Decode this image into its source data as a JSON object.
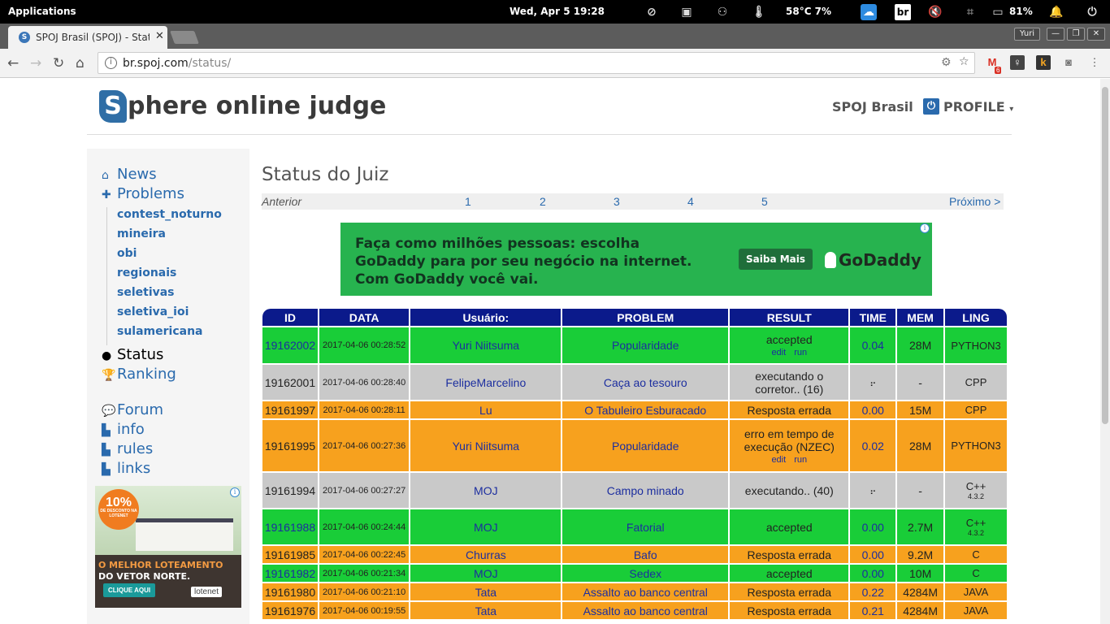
{
  "system_bar": {
    "applications": "Applications",
    "datetime": "Wed, Apr 5   19:28",
    "temperature": "58°C 7%",
    "keyboard": "br",
    "battery": "81%"
  },
  "browser": {
    "tab_title": "SPOJ Brasil (SPOJ) - Stat",
    "user": "Yuri",
    "url_host": "br.spoj.com",
    "url_path": "/status/",
    "gmail_badge": "6"
  },
  "site": {
    "logo_letter": "S",
    "logo_rest": "phere online judge",
    "brand": "SPOJ Brasil",
    "profile": "PROFILE"
  },
  "sidebar": {
    "main_top": [
      {
        "label": "News",
        "icon": "home-icon"
      },
      {
        "label": "Problems",
        "icon": "puzzle-icon"
      }
    ],
    "problem_groups": [
      "contest_noturno",
      "mineira",
      "obi",
      "regionais",
      "seletivas",
      "seletiva_ioi",
      "sulamericana"
    ],
    "status": "Status",
    "ranking": "Ranking",
    "forum": "Forum",
    "pages": [
      "info",
      "rules",
      "links"
    ]
  },
  "page": {
    "title": "Status do Juiz",
    "prev": "Anterior",
    "pages": [
      "1",
      "2",
      "3",
      "4",
      "5"
    ],
    "next": "Próximo >"
  },
  "ad_banner": {
    "line1": "Faça como milhões pessoas: escolha",
    "line2": "GoDaddy para por seu negócio na internet.",
    "line3": "Com GoDaddy você vai.",
    "button": "Saiba Mais",
    "brand": "GoDaddy"
  },
  "ad_side": {
    "discount": "10%",
    "discount_sub": "DE DESCONTO NA LOTENET",
    "line1": "O MELHOR LOTEAMENTO",
    "line2": "DO VETOR NORTE.",
    "cta": "CLIQUE AQUI",
    "brand": "lotenet"
  },
  "table": {
    "headers": [
      "ID",
      "DATA",
      "Usuário:",
      "PROBLEM",
      "RESULT",
      "TIME",
      "MEM",
      "LING"
    ],
    "edit": "edit",
    "run": "run",
    "rows": [
      {
        "id": "19162002",
        "date": "2017-04-06 00:28:52",
        "user": "Yuri Niitsuma",
        "problem": "Popularidade",
        "result": "accepted",
        "time": "0.04",
        "mem": "28M",
        "lang": "PYTHON3",
        "lang_ver": "",
        "status": "ok",
        "editable": true
      },
      {
        "id": "19162001",
        "date": "2017-04-06 00:28:40",
        "user": "FelipeMarcelino",
        "problem": "Caça ao tesouro",
        "result": "executando o corretor.. (16)",
        "time": "",
        "mem": "-",
        "lang": "CPP",
        "lang_ver": "",
        "status": "run",
        "editable": false
      },
      {
        "id": "19161997",
        "date": "2017-04-06 00:28:11",
        "user": "Lu",
        "problem": "O Tabuleiro Esburacado",
        "result": "Resposta errada",
        "time": "0.00",
        "mem": "15M",
        "lang": "CPP",
        "lang_ver": "",
        "status": "wa",
        "editable": false
      },
      {
        "id": "19161995",
        "date": "2017-04-06 00:27:36",
        "user": "Yuri Niitsuma",
        "problem": "Popularidade",
        "result": "erro em tempo de execução (NZEC)",
        "time": "0.02",
        "mem": "28M",
        "lang": "PYTHON3",
        "lang_ver": "",
        "status": "wa",
        "editable": true
      },
      {
        "id": "19161994",
        "date": "2017-04-06 00:27:27",
        "user": "MOJ",
        "problem": "Campo minado",
        "result": "executando.. (40)",
        "time": "",
        "mem": "-",
        "lang": "C++",
        "lang_ver": "4.3.2",
        "status": "run",
        "editable": false
      },
      {
        "id": "19161988",
        "date": "2017-04-06 00:24:44",
        "user": "MOJ",
        "problem": "Fatorial",
        "result": "accepted",
        "time": "0.00",
        "mem": "2.7M",
        "lang": "C++",
        "lang_ver": "4.3.2",
        "status": "ok",
        "editable": false
      },
      {
        "id": "19161985",
        "date": "2017-04-06 00:22:45",
        "user": "Churras",
        "problem": "Bafo",
        "result": "Resposta errada",
        "time": "0.00",
        "mem": "9.2M",
        "lang": "C",
        "lang_ver": "",
        "status": "wa",
        "editable": false
      },
      {
        "id": "19161982",
        "date": "2017-04-06 00:21:34",
        "user": "MOJ",
        "problem": "Sedex",
        "result": "accepted",
        "time": "0.00",
        "mem": "10M",
        "lang": "C",
        "lang_ver": "",
        "status": "ok",
        "editable": false
      },
      {
        "id": "19161980",
        "date": "2017-04-06 00:21:10",
        "user": "Tata",
        "problem": "Assalto ao banco central",
        "result": "Resposta errada",
        "time": "0.22",
        "mem": "4284M",
        "lang": "JAVA",
        "lang_ver": "",
        "status": "wa",
        "editable": false
      },
      {
        "id": "19161976",
        "date": "2017-04-06 00:19:55",
        "user": "Tata",
        "problem": "Assalto ao banco central",
        "result": "Resposta errada",
        "time": "0.21",
        "mem": "4284M",
        "lang": "JAVA",
        "lang_ver": "",
        "status": "wa",
        "editable": false
      }
    ]
  },
  "colors": {
    "accepted": "#19cd38",
    "wrong": "#f7a11e",
    "running": "#c9c9c9",
    "header": "#0b1a8b",
    "link": "#2a6aad"
  }
}
